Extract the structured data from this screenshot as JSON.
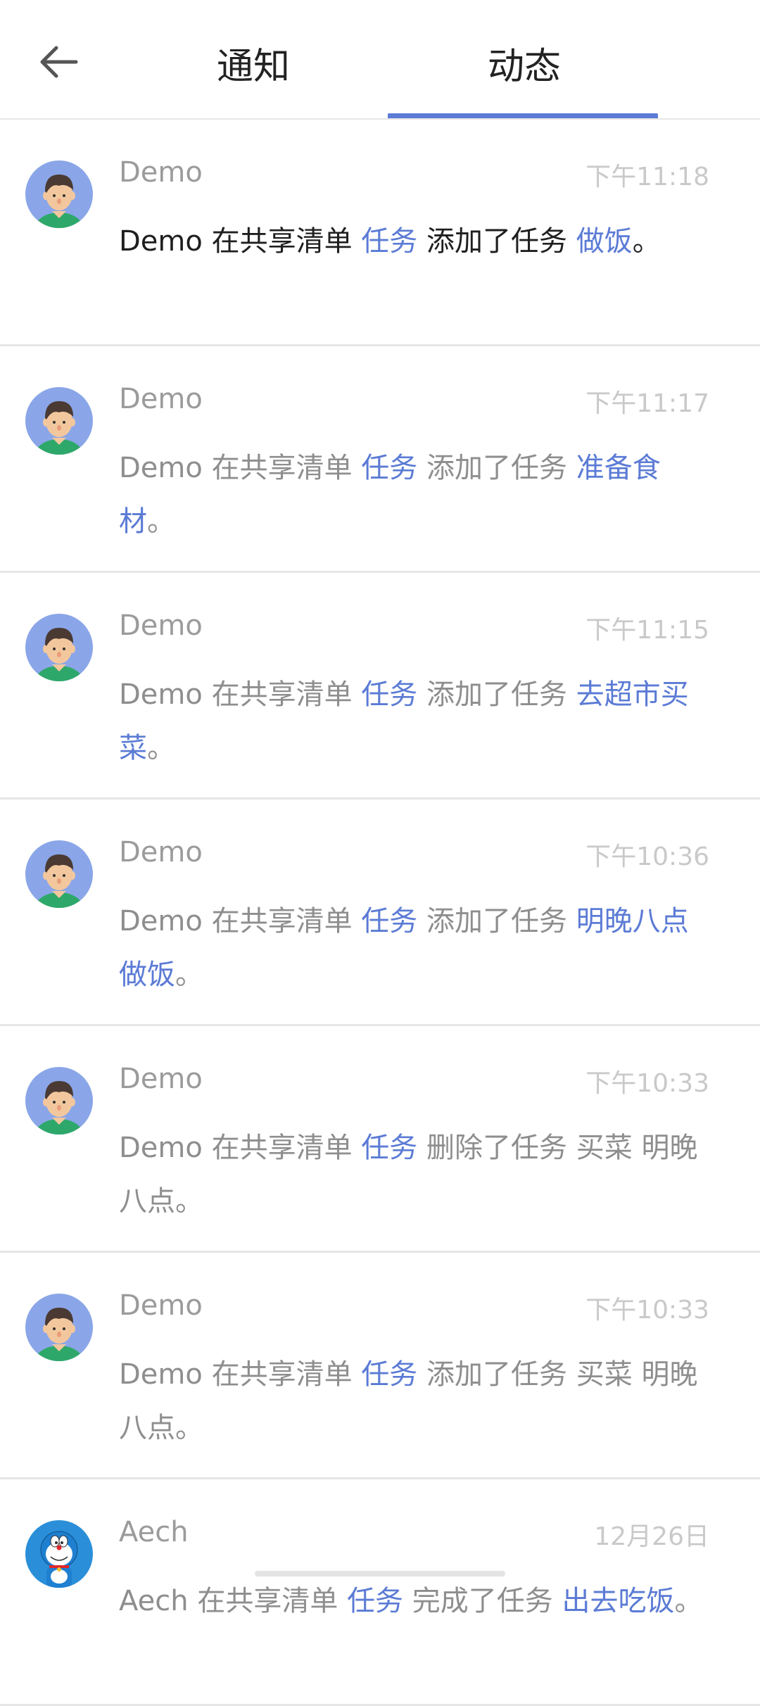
{
  "header": {
    "tabs": [
      {
        "label": "通知",
        "active": false
      },
      {
        "label": "动态",
        "active": true
      }
    ],
    "accent_color": "#5b7bd5"
  },
  "feed": [
    {
      "avatar": "male-avatar",
      "name": "Demo",
      "time": "下午11:18",
      "actor": "Demo",
      "mid1": " 在共享清单 ",
      "list": "任务",
      "action": " 添加了任务 ",
      "task": "做饭",
      "end": "。"
    },
    {
      "avatar": "male-avatar",
      "name": "Demo",
      "time": "下午11:17",
      "actor": "Demo",
      "mid1": " 在共享清单 ",
      "list": "任务",
      "action": " 添加了任务 ",
      "task": "准备食材",
      "end": "。"
    },
    {
      "avatar": "male-avatar",
      "name": "Demo",
      "time": "下午11:15",
      "actor": "Demo",
      "mid1": " 在共享清单 ",
      "list": "任务",
      "action": " 添加了任务 ",
      "task": "去超市买菜",
      "end": "。"
    },
    {
      "avatar": "male-avatar",
      "name": "Demo",
      "time": "下午10:36",
      "actor": "Demo",
      "mid1": " 在共享清单 ",
      "list": "任务",
      "action": " 添加了任务 ",
      "task": "明晚八点做饭",
      "end": "。"
    },
    {
      "avatar": "male-avatar",
      "name": "Demo",
      "time": "下午10:33",
      "actor": "Demo",
      "mid1": " 在共享清单 ",
      "list": "任务",
      "action": " 删除了任务 买菜 明晚八点",
      "task": "",
      "end": "。"
    },
    {
      "avatar": "male-avatar",
      "name": "Demo",
      "time": "下午10:33",
      "actor": "Demo",
      "mid1": " 在共享清单 ",
      "list": "任务",
      "action": " 添加了任务 买菜 明晚八点",
      "task": "",
      "end": "。"
    },
    {
      "avatar": "doraemon-avatar",
      "name": "Aech",
      "time": "12月26日",
      "actor": "Aech",
      "mid1": " 在共享清单 ",
      "list": "任务",
      "action": " 完成了任务 ",
      "task": "出去吃饭",
      "end": "。"
    }
  ]
}
